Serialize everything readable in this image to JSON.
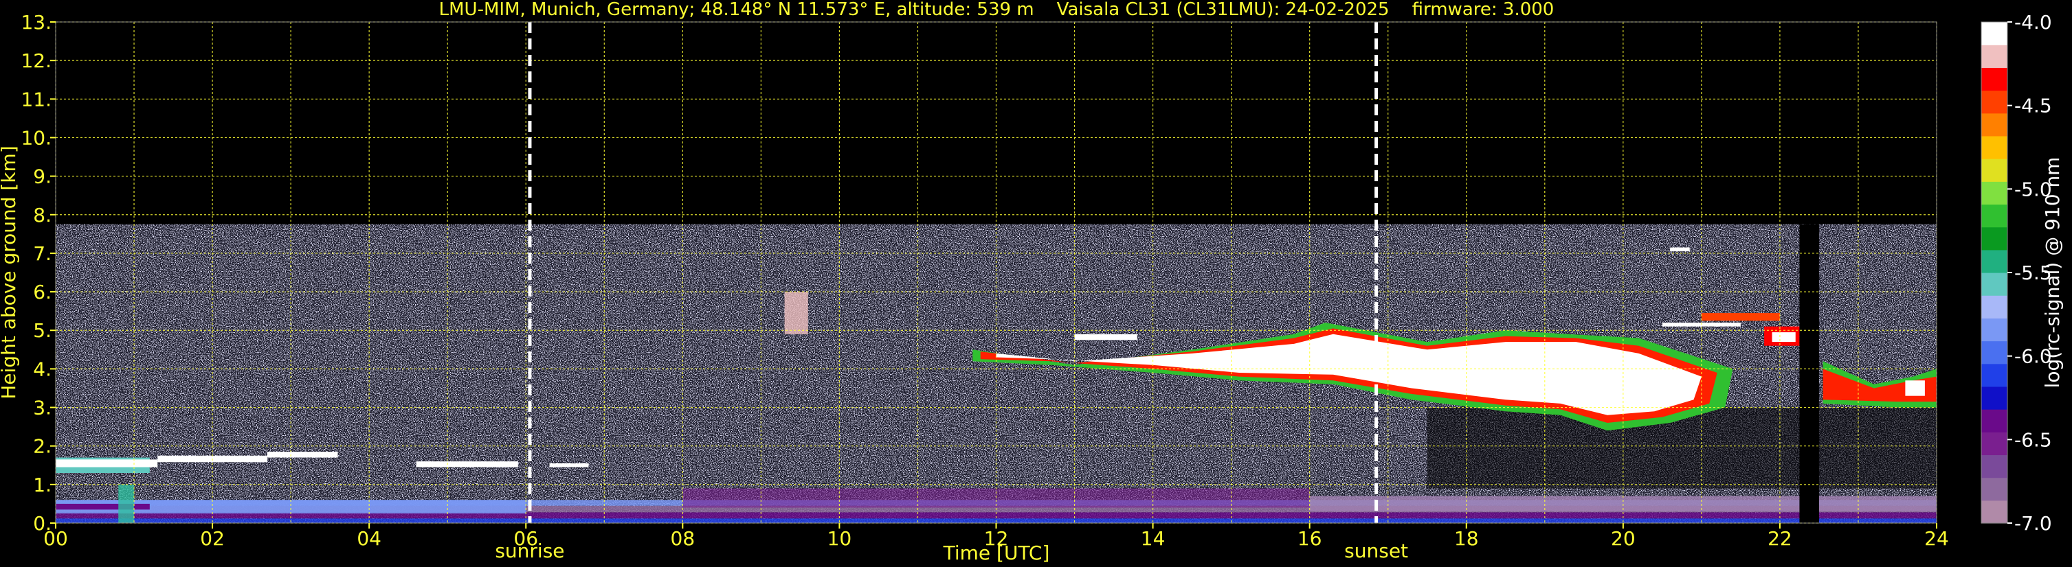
{
  "chart_data": {
    "type": "heatmap",
    "title": "LMU-MIM, Munich, Germany; 48.148° N 11.573° E, altitude: 539 m    Vaisala CL31 (CL31LMU): 24-02-2025    firmware: 3.000",
    "xlabel": "Time [UTC]",
    "ylabel": "Height above ground [km]",
    "xlim": [
      0,
      24
    ],
    "ylim": [
      0,
      13
    ],
    "x_ticks": [
      "00",
      "02",
      "04",
      "06",
      "08",
      "10",
      "12",
      "14",
      "16",
      "18",
      "20",
      "22",
      "24"
    ],
    "y_ticks": [
      "0.",
      "1.",
      "2.",
      "3.",
      "4.",
      "5.",
      "6.",
      "7.",
      "8.",
      "9.",
      "10.",
      "11.",
      "12.",
      "13."
    ],
    "grid": true,
    "colorbar": {
      "label": "log(rc-signal) @ 910 nm",
      "range": [
        -7.0,
        -4.0
      ],
      "ticks": [
        "-4.0",
        "-4.5",
        "-5.0",
        "-5.5",
        "-6.0",
        "-6.5",
        "-7.0"
      ]
    },
    "markers": [
      {
        "x": 6.05,
        "label": "sunrise"
      },
      {
        "x": 16.85,
        "label": "sunset"
      }
    ],
    "signal_max_height_km": 7.75,
    "features": [
      {
        "name": "surface aerosol layer",
        "x": [
          0,
          24
        ],
        "y": [
          0,
          0.6
        ]
      },
      {
        "name": "low cloud",
        "x": [
          0,
          3.6
        ],
        "y": [
          1.4,
          1.7
        ]
      },
      {
        "name": "cloud layer",
        "x": [
          12,
          21.5
        ],
        "y": [
          2.6,
          5.1
        ]
      },
      {
        "name": "cloud layer",
        "x": [
          22.5,
          24
        ],
        "y": [
          3.0,
          4.2
        ]
      },
      {
        "name": "data gap",
        "x": [
          22.25,
          22.5
        ],
        "y": [
          0,
          7.75
        ]
      }
    ]
  },
  "colors": {
    "axis": "#ffff33",
    "grid": "#ffff33",
    "background": "#000000",
    "colormap": [
      "#b08aa8",
      "#8e6a9e",
      "#7a4a9a",
      "#7a1f8f",
      "#6a0a8a",
      "#1010c8",
      "#2040e8",
      "#4a70f0",
      "#7a98f4",
      "#a8b8f8",
      "#60c8c0",
      "#20b080",
      "#0a9a20",
      "#30c030",
      "#80e040",
      "#e0e020",
      "#ffc000",
      "#ff8000",
      "#ff4000",
      "#ff0000",
      "#f0c0c0",
      "#ffffff"
    ]
  }
}
